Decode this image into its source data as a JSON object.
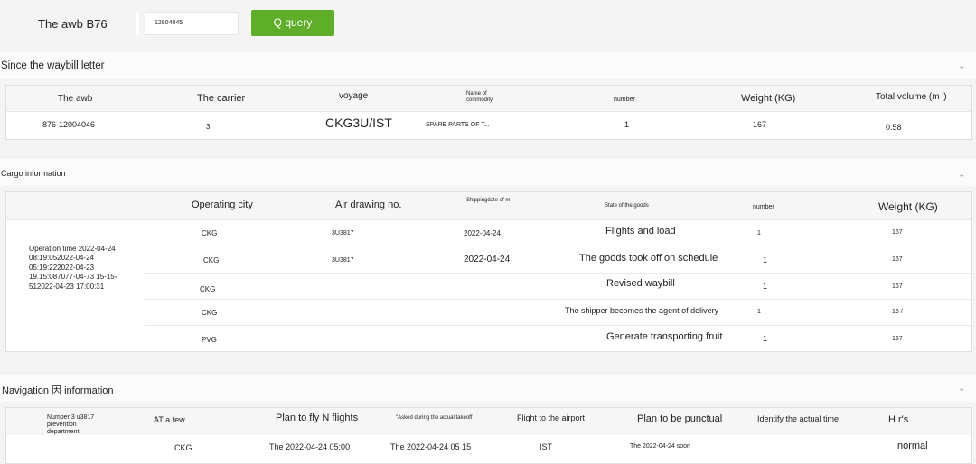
{
  "search": {
    "label": "The awb B76",
    "input_value": "12804045",
    "query_button": "Q query"
  },
  "waybill": {
    "title": "Since the waybill letter",
    "headers": [
      "The awb",
      "The carrier",
      "voyage",
      "Name of commodity",
      "number",
      "Weight (KG)",
      "Total volume (m ')"
    ],
    "row": [
      "876-12004046",
      "3",
      "CKG3U/IST",
      "SPARE PARTS OF T...",
      "1",
      "167",
      "0.58"
    ]
  },
  "cargo": {
    "title": "Cargo information",
    "headers": [
      "Operating city",
      "Air drawing no.",
      "Shippingdate of m",
      "State of the goods",
      "number",
      "Weight (KG)"
    ],
    "operation_time": "Operation time 2022-04-24 08:19:052022-04-24 05:19:222022-04-23 19.15:087077-04-73 15-15-512022-04-23 17:00:31",
    "rows": [
      [
        "CKG",
        "3U3817",
        "2022-04-24",
        "Flights and load",
        "1",
        "167"
      ],
      [
        "CKG",
        "3U3817",
        "2022-04-24",
        "The goods took off on schedule",
        "1",
        "167"
      ],
      [
        "CKG",
        "",
        "",
        "Revised waybill",
        "1",
        "167"
      ],
      [
        "CKG",
        "",
        "",
        "The shipper becomes the agent of delivery",
        "1",
        "16 /"
      ],
      [
        "PVG",
        "",
        "",
        "Generate transporting fruit",
        "1",
        "167"
      ]
    ]
  },
  "navigation": {
    "title": "Navigation 因 information",
    "headers": [
      "Number 3 u3817 prevention department",
      "AT a few",
      "Plan to fly N flights",
      "\"Asked during the actual takeoff",
      "Flight to the airport",
      "Plan to be punctual",
      "Identify the actual time",
      "H r's"
    ],
    "row": [
      "CKG",
      "The 2022-04-24 05:00",
      "The 2022-04-24 05 15",
      "IST",
      "The 2022-04-24 soon",
      "normal"
    ]
  }
}
